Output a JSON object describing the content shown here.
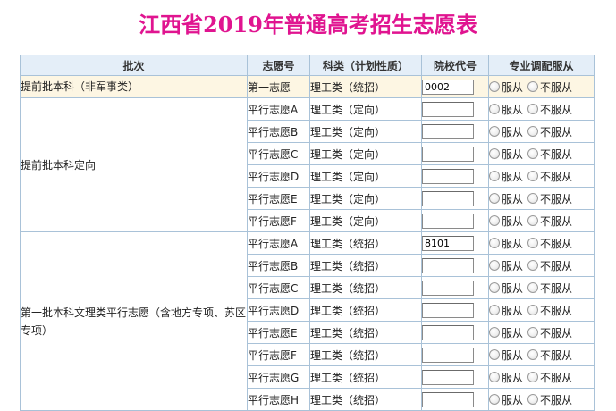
{
  "title": "江西省2019年普通高考招生志愿表",
  "headers": {
    "batch": "批次",
    "order": "志愿号",
    "type": "科类（计划性质）",
    "code": "院校代号",
    "adjust": "专业调配服从"
  },
  "radio_labels": {
    "obey": "服从",
    "disobey": "不服从"
  },
  "groups": [
    {
      "batch": "提前批本科（非军事类）",
      "rows": [
        {
          "order": "第一志愿",
          "type": "理工类（统招）",
          "code": "0002"
        }
      ]
    },
    {
      "batch": "提前批本科定向",
      "rows": [
        {
          "order": "平行志愿A",
          "type": "理工类（定向）",
          "code": ""
        },
        {
          "order": "平行志愿B",
          "type": "理工类（定向）",
          "code": ""
        },
        {
          "order": "平行志愿C",
          "type": "理工类（定向）",
          "code": ""
        },
        {
          "order": "平行志愿D",
          "type": "理工类（定向）",
          "code": ""
        },
        {
          "order": "平行志愿E",
          "type": "理工类（定向）",
          "code": ""
        },
        {
          "order": "平行志愿F",
          "type": "理工类（定向）",
          "code": ""
        }
      ]
    },
    {
      "batch": "第一批本科文理类平行志愿（含地方专项、苏区专项）",
      "rows": [
        {
          "order": "平行志愿A",
          "type": "理工类（统招）",
          "code": "8101"
        },
        {
          "order": "平行志愿B",
          "type": "理工类（统招）",
          "code": ""
        },
        {
          "order": "平行志愿C",
          "type": "理工类（统招）",
          "code": ""
        },
        {
          "order": "平行志愿D",
          "type": "理工类（统招）",
          "code": ""
        },
        {
          "order": "平行志愿E",
          "type": "理工类（统招）",
          "code": ""
        },
        {
          "order": "平行志愿F",
          "type": "理工类（统招）",
          "code": ""
        },
        {
          "order": "平行志愿G",
          "type": "理工类（统招）",
          "code": ""
        },
        {
          "order": "平行志愿H",
          "type": "理工类（统招）",
          "code": ""
        }
      ]
    }
  ]
}
